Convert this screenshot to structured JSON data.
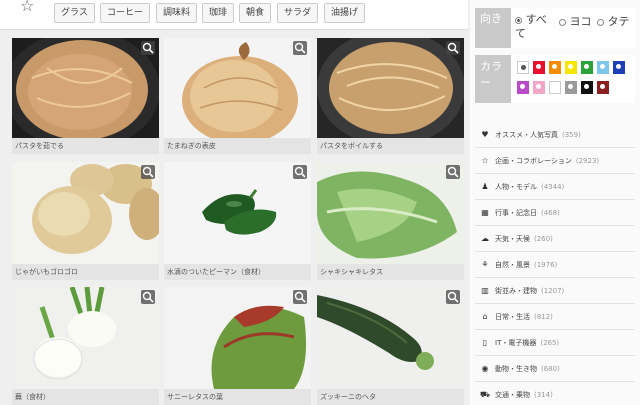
{
  "tags": [
    "グラス",
    "コーヒー",
    "調味料",
    "珈琲",
    "朝食",
    "サラダ",
    "油揚げ"
  ],
  "photos": [
    {
      "caption": "パスタを茹でる"
    },
    {
      "caption": "たまねぎの表皮"
    },
    {
      "caption": "パスタをボイルする"
    },
    {
      "caption": "じゃがいもゴロゴロ"
    },
    {
      "caption": "水滴のついたピーマン（食材）"
    },
    {
      "caption": "シャキシャキレタス"
    },
    {
      "caption": "蕪（食材）"
    },
    {
      "caption": "サニーレタスの葉"
    },
    {
      "caption": "ズッキーニのヘタ"
    }
  ],
  "filters": {
    "orientation_label": "向き",
    "orientation_options": [
      "すべて",
      "ヨコ",
      "タテ"
    ],
    "orientation_selected": "すべて",
    "color_label": "カラー",
    "colors": [
      "#ffffff",
      "#e8112d",
      "#f28c00",
      "#f5e600",
      "#2aa33a",
      "#7fc7e8",
      "#1f3fb5",
      "#b84cc8",
      "#f3a7c7",
      "#ffffff",
      "#9a9a9a",
      "#111111",
      "#8a1f1f"
    ]
  },
  "categories": [
    {
      "icon": "heart-icon",
      "glyph": "♥",
      "name": "オススメ・人気写真",
      "count": "(359)"
    },
    {
      "icon": "star-icon",
      "glyph": "☆",
      "name": "企画・コラボレーション",
      "count": "(2923)"
    },
    {
      "icon": "person-icon",
      "glyph": "♟",
      "name": "人物・モデル",
      "count": "(4344)"
    },
    {
      "icon": "calendar-icon",
      "glyph": "▦",
      "name": "行事・記念日",
      "count": "(468)"
    },
    {
      "icon": "cloud-icon",
      "glyph": "☁",
      "name": "天気・天候",
      "count": "(260)"
    },
    {
      "icon": "plant-icon",
      "glyph": "⚘",
      "name": "自然・風景",
      "count": "(1976)"
    },
    {
      "icon": "building-icon",
      "glyph": "▥",
      "name": "街並み・建物",
      "count": "(1207)"
    },
    {
      "icon": "house-icon",
      "glyph": "⌂",
      "name": "日常・生活",
      "count": "(812)"
    },
    {
      "icon": "phone-icon",
      "glyph": "▯",
      "name": "IT・電子機器",
      "count": "(265)"
    },
    {
      "icon": "globe-icon",
      "glyph": "◉",
      "name": "動物・生き物",
      "count": "(680)"
    },
    {
      "icon": "car-icon",
      "glyph": "⛟",
      "name": "交通・乗物",
      "count": "(314)"
    }
  ]
}
